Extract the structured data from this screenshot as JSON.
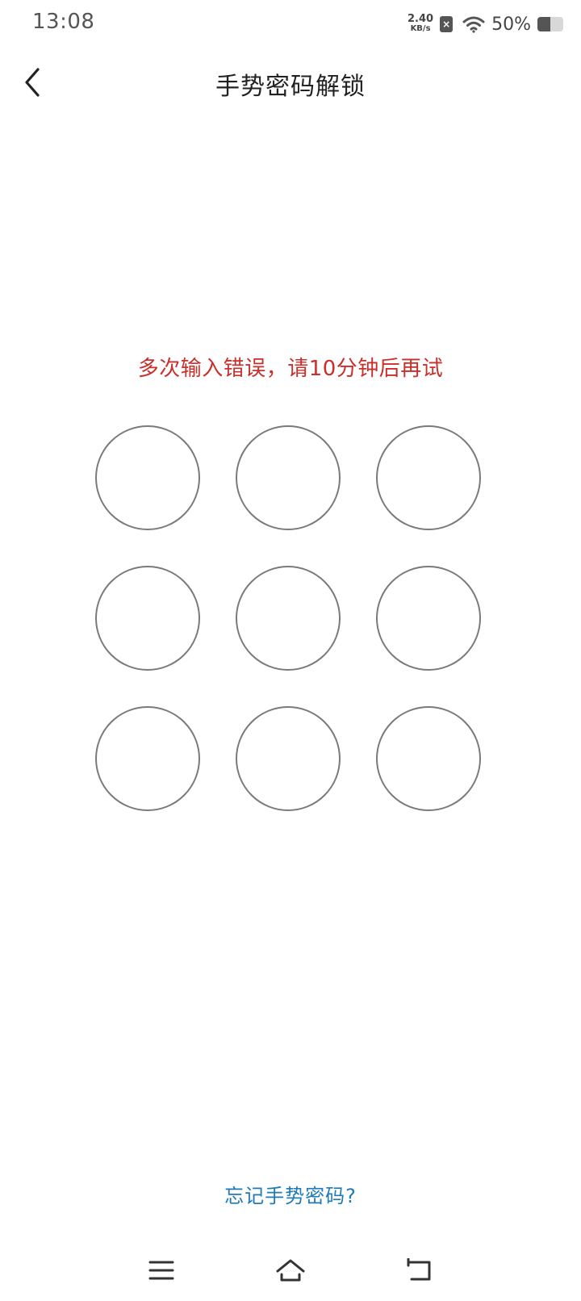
{
  "status_bar": {
    "time": "13:08",
    "net_speed_value": "2.40",
    "net_speed_unit": "KB/s",
    "sim_icon": "sim-x-icon",
    "battery_percent": "50%",
    "battery_level": 0.5
  },
  "header": {
    "title": "手势密码解锁",
    "back_icon": "chevron-left-icon"
  },
  "error_message": "多次输入错误，请10分钟后再试",
  "colors": {
    "error": "#c9302c",
    "link": "#1f7ab8",
    "dot_border": "#7a7a7a"
  },
  "gesture_dots": [
    {
      "id": 1
    },
    {
      "id": 2
    },
    {
      "id": 3
    },
    {
      "id": 4
    },
    {
      "id": 5
    },
    {
      "id": 6
    },
    {
      "id": 7
    },
    {
      "id": 8
    },
    {
      "id": 9
    }
  ],
  "forgot_link": "忘记手势密码?",
  "nav_bar": {
    "menu_icon": "menu-icon",
    "home_icon": "home-icon",
    "back_icon": "back-icon"
  }
}
